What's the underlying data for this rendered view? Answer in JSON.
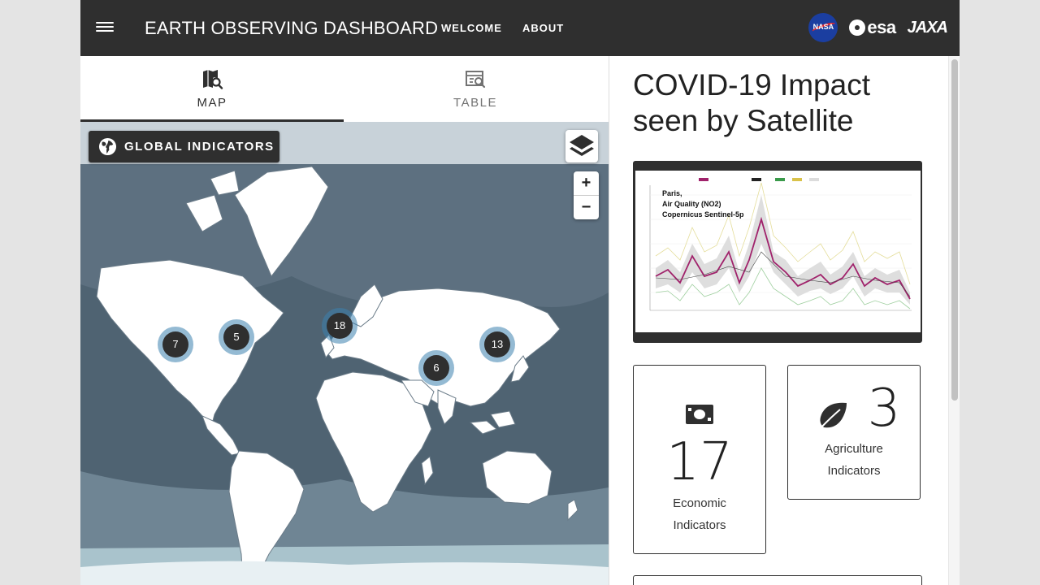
{
  "header": {
    "title": "EARTH OBSERVING DASHBOARD",
    "nav": [
      {
        "label": "WELCOME"
      },
      {
        "label": "ABOUT"
      }
    ],
    "logos": {
      "nasa": "NASA",
      "esa": "esa",
      "jaxa": "JAXA"
    }
  },
  "tabs": [
    {
      "label": "MAP",
      "icon": "map-search-icon",
      "active": true
    },
    {
      "label": "TABLE",
      "icon": "table-search-icon",
      "active": false
    }
  ],
  "map": {
    "indicator_button": "GLOBAL INDICATORS",
    "zoom_in": "+",
    "zoom_out": "−",
    "clusters": [
      {
        "count": "7"
      },
      {
        "count": "5"
      },
      {
        "count": "18"
      },
      {
        "count": "13"
      },
      {
        "count": "6"
      }
    ]
  },
  "story": {
    "title": "COVID-19 Impact seen by Satellite",
    "chart_caption": [
      "Paris,",
      "Air Quality (NO2)",
      "Copernicus Sentinel-5p"
    ]
  },
  "cards": [
    {
      "value": "17",
      "label_line1": "Economic",
      "label_line2": "Indicators",
      "icon": "money-icon"
    },
    {
      "value": "3",
      "label_line1": "Agriculture",
      "label_line2": "Indicators",
      "icon": "leaf-icon"
    }
  ],
  "colors": {
    "header_bg": "#2f2f2f",
    "ocean": "#5a6d7c",
    "land": "#ffffff",
    "cluster_ring": "#3c82af",
    "chart_line": "#a0226b"
  }
}
